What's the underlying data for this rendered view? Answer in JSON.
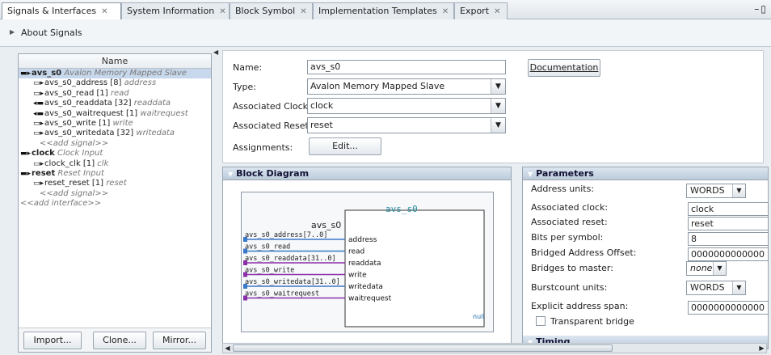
{
  "tabs": [
    {
      "label": "Signals & Interfaces",
      "active": true
    },
    {
      "label": "System Information"
    },
    {
      "label": "Block Symbol"
    },
    {
      "label": "Implementation Templates"
    },
    {
      "label": "Export"
    }
  ],
  "about": {
    "label": "About Signals"
  },
  "tree": {
    "header": "Name",
    "rows": [
      {
        "name": "avs_s0",
        "desc": "Avalon Memory Mapped Slave"
      },
      {
        "name": "avs_s0_address [8]",
        "desc": "address"
      },
      {
        "name": "avs_s0_read [1]",
        "desc": "read"
      },
      {
        "name": "avs_s0_readdata [32]",
        "desc": "readdata"
      },
      {
        "name": "avs_s0_waitrequest [1]",
        "desc": "waitrequest"
      },
      {
        "name": "avs_s0_write [1]",
        "desc": "write"
      },
      {
        "name": "avs_s0_writedata [32]",
        "desc": "writedata"
      },
      {
        "name": "<<add signal>>"
      },
      {
        "name": "clock",
        "desc": "Clock Input"
      },
      {
        "name": "clock_clk [1]",
        "desc": "clk"
      },
      {
        "name": "reset",
        "desc": "Reset Input"
      },
      {
        "name": "reset_reset [1]",
        "desc": "reset"
      },
      {
        "name": "<<add signal>>"
      },
      {
        "name": "<<add interface>>"
      }
    ]
  },
  "left_buttons": {
    "import": "Import...",
    "clone": "Clone...",
    "mirror": "Mirror..."
  },
  "form": {
    "name_label": "Name:",
    "name_value": "avs_s0",
    "type_label": "Type:",
    "type_value": "Avalon Memory Mapped Slave",
    "clock_label": "Associated Clock:",
    "clock_value": "clock",
    "reset_label": "Associated Reset:",
    "reset_value": "reset",
    "assign_label": "Assignments:",
    "edit_label": "Edit...",
    "doc_label": "Documentation"
  },
  "block_diagram": {
    "title": "Block Diagram",
    "component": "avs_s0",
    "inner_label": "avs_s0",
    "null_label": "null",
    "signals": [
      {
        "ext": "avs_s0_address[7..0]",
        "port": "address",
        "color": "#3a78c8"
      },
      {
        "ext": "avs_s0_read",
        "port": "read",
        "color": "#3a78c8"
      },
      {
        "ext": "avs_s0_readdata[31..0]",
        "port": "readdata",
        "color": "#8a2fa8"
      },
      {
        "ext": "avs_s0_write",
        "port": "write",
        "color": "#8a2fa8"
      },
      {
        "ext": "avs_s0_writedata[31..0]",
        "port": "writedata",
        "color": "#3a78c8"
      },
      {
        "ext": "avs_s0_waitrequest",
        "port": "waitrequest",
        "color": "#8a2fa8"
      }
    ]
  },
  "parameters": {
    "title": "Parameters",
    "rows": [
      {
        "label": "Address units:",
        "value": "WORDS"
      },
      {
        "label": "Associated clock:",
        "value": "clock"
      },
      {
        "label": "Associated reset:",
        "value": "reset"
      },
      {
        "label": "Bits per symbol:",
        "value": "8"
      },
      {
        "label": "Bridged Address Offset:",
        "value": "0000000000000"
      },
      {
        "label": "Bridges to master:",
        "value": "none"
      },
      {
        "label": "Burstcount units:",
        "value": "WORDS"
      },
      {
        "label": "Explicit address span:",
        "value": "0000000000000"
      }
    ],
    "transparent_bridge": "Transparent bridge",
    "timing_title": "Timing"
  }
}
